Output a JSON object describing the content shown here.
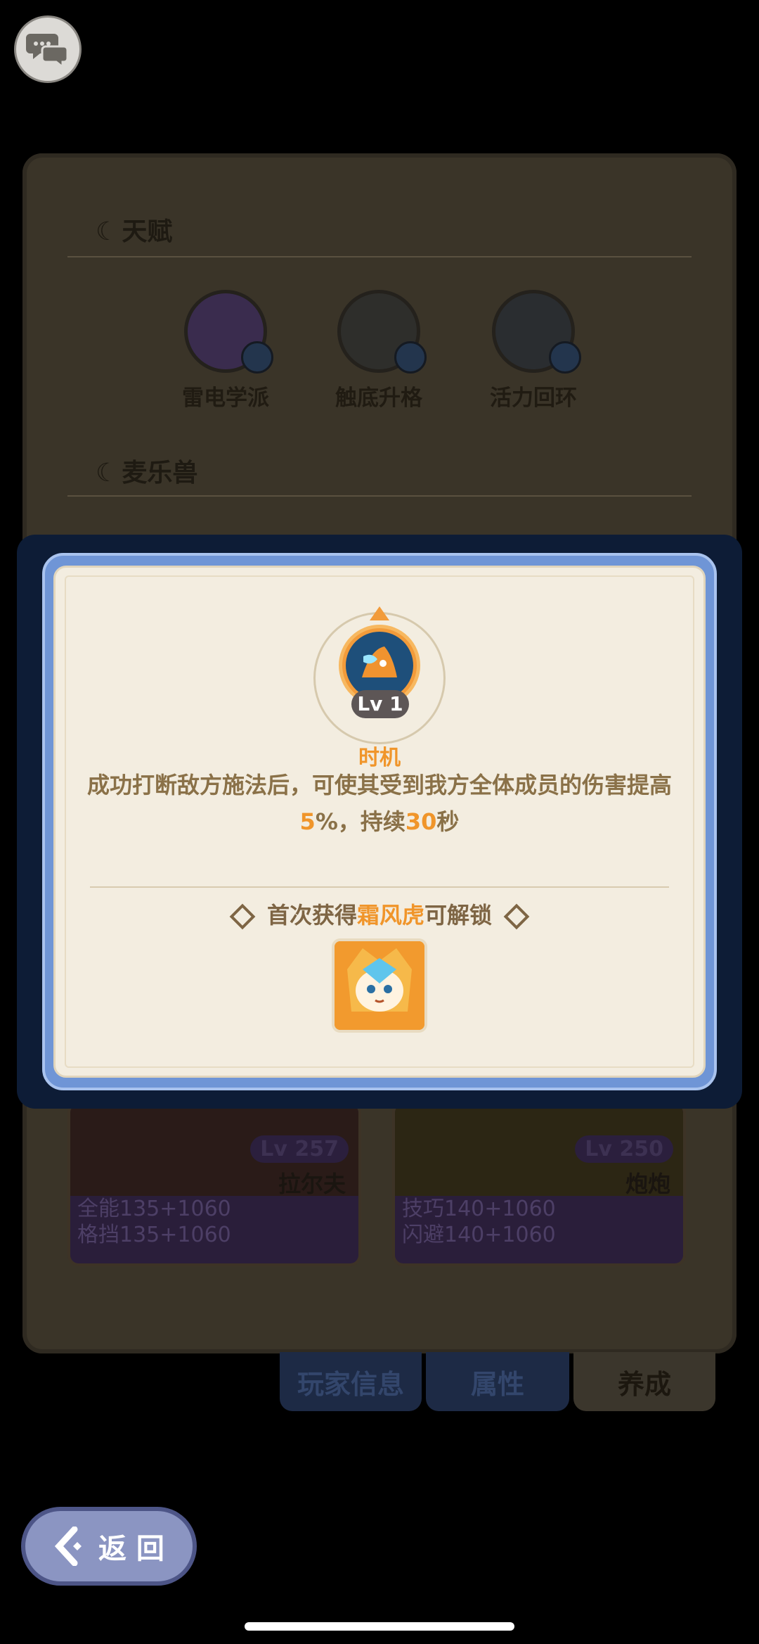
{
  "background": {
    "talent_title": "天赋",
    "talents": [
      {
        "label": "雷电学派",
        "color": "#3a2c4e"
      },
      {
        "label": "触底升格",
        "color": "#2e2e2b"
      },
      {
        "label": "活力回环",
        "color": "#2a2d30"
      }
    ],
    "pets_title": "麦乐兽",
    "pet_cards": [
      {
        "level": "Lv 257",
        "name": "拉尔夫",
        "stat1": "全能135+1060",
        "stat2": "格挡135+1060"
      },
      {
        "level": "Lv 250",
        "name": "炮炮",
        "stat1": "技巧140+1060",
        "stat2": "闪避140+1060"
      }
    ],
    "tabs": [
      "玩家信息",
      "属性",
      "养成"
    ],
    "back_label": "返 回"
  },
  "modal": {
    "level": "Lv 1",
    "skill_name": "时机",
    "desc_part1": "成功打断敌方施法后，可使其受到我方全体成员的伤害提高",
    "desc_val1": "5",
    "desc_part2": "%，持续",
    "desc_val2": "30",
    "desc_part3": "秒",
    "unlock_prefix": "首次获得",
    "unlock_pet": "霜风虎",
    "unlock_suffix": "可解锁"
  },
  "colors": {
    "accent": "#f0952a",
    "modal_frame": "#6f95d6",
    "panel_bg": "#f3ede0"
  }
}
